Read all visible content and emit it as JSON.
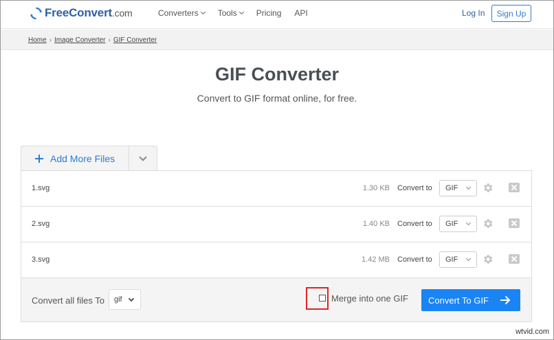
{
  "header": {
    "logo_name": "FreeConvert",
    "logo_suffix": ".com",
    "nav": [
      "Converters",
      "Tools",
      "Pricing",
      "API"
    ],
    "login": "Log In",
    "signup": "Sign Up"
  },
  "breadcrumb": [
    "Home",
    "Image Converter",
    "GIF Converter"
  ],
  "page": {
    "title": "GIF Converter",
    "subtitle": "Convert to GIF format online, for free."
  },
  "add_files": {
    "label": "Add More Files"
  },
  "files": [
    {
      "name": "1.svg",
      "size": "1.30 KB",
      "convert_to_label": "Convert to",
      "format": "GIF"
    },
    {
      "name": "2.svg",
      "size": "1.40 KB",
      "convert_to_label": "Convert to",
      "format": "GIF"
    },
    {
      "name": "3.svg",
      "size": "1.42 MB",
      "convert_to_label": "Convert to",
      "format": "GIF"
    }
  ],
  "bottom": {
    "convert_all_label": "Convert all files To",
    "convert_all_format": "gif",
    "merge_label": "Merge into one GIF",
    "merge_checked": false,
    "convert_button": "Convert To GIF"
  },
  "colors": {
    "primary": "#1a84f5",
    "brand": "#2d5fa8",
    "highlight": "#e02424"
  },
  "watermark": "wtvid.com"
}
